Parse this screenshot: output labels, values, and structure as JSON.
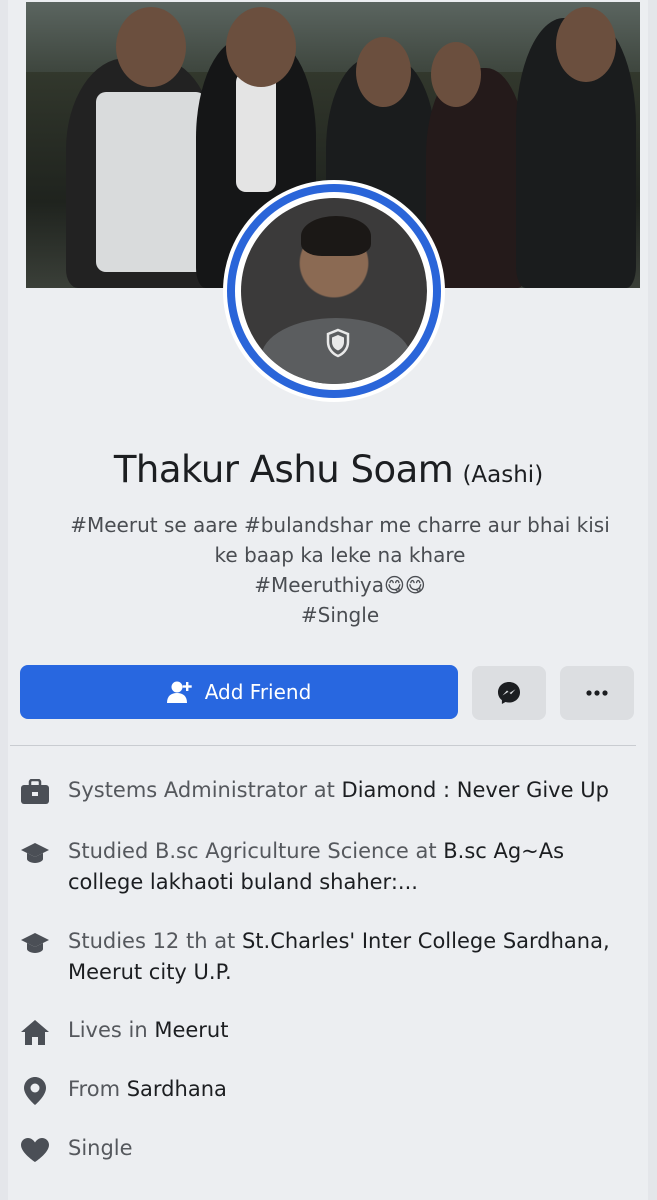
{
  "profile": {
    "name": "Thakur Ashu Soam",
    "alt_name": "(Aashi)",
    "bio_lines": [
      "#Meerut se aare #bulandshar me charre aur bhai kisi",
      "ke baap ka leke na khare",
      "#Meeruthiya😋😋",
      "#Single"
    ]
  },
  "actions": {
    "add_friend_label": "Add Friend",
    "add_friend_icon": "add-user-icon",
    "messenger_icon": "messenger-icon",
    "more_icon": "more-icon"
  },
  "details": [
    {
      "icon": "briefcase-icon",
      "prefix": "Systems Administrator at ",
      "value": "Diamond : Never Give Up"
    },
    {
      "icon": "graduation-cap-icon",
      "prefix": "Studied B.sc Agriculture Science at ",
      "value": "B.sc Ag~As college lakhaoti buland shaher:..."
    },
    {
      "icon": "graduation-cap-icon",
      "prefix": "Studies 12 th at ",
      "value": "St.Charles' Inter College Sardhana, Meerut city  U.P."
    },
    {
      "icon": "home-icon",
      "prefix": "Lives in ",
      "value": "Meerut"
    },
    {
      "icon": "location-pin-icon",
      "prefix": "From ",
      "value": "Sardhana"
    },
    {
      "icon": "heart-icon",
      "prefix": "Single",
      "value": ""
    }
  ],
  "colors": {
    "accent": "#2867e0",
    "avatar_ring": "#2a65d9",
    "background": "#eceef1"
  }
}
